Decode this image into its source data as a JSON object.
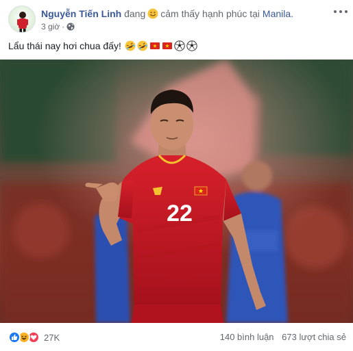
{
  "post": {
    "author": "Nguyễn Tiến Linh",
    "feeling_prefix": "đang",
    "feeling": "cảm thấy hạnh phúc tại",
    "location": "Manila.",
    "time": "3 giờ",
    "separator": "·",
    "privacy_icon": "globe-icon",
    "text": "Lẩu thái nay hơi chua đấy!",
    "text_emojis": [
      "rofl-emoji",
      "rofl-emoji",
      "vietnam-flag-emoji",
      "vietnam-flag-emoji",
      "soccer-ball-emoji",
      "soccer-ball-emoji"
    ],
    "jersey_number": "22"
  },
  "footer": {
    "reaction_icons": [
      "like-icon",
      "haha-icon",
      "love-icon"
    ],
    "reaction_count": "27K",
    "comments": "140 bình luận",
    "shares": "673 lượt chia sẻ"
  },
  "colors": {
    "link": "#385898",
    "muted": "#616770",
    "jersey_red": "#c8102e",
    "like_blue": "#1877f2",
    "love_red": "#f33e58",
    "haha_yellow": "#f7b125"
  }
}
